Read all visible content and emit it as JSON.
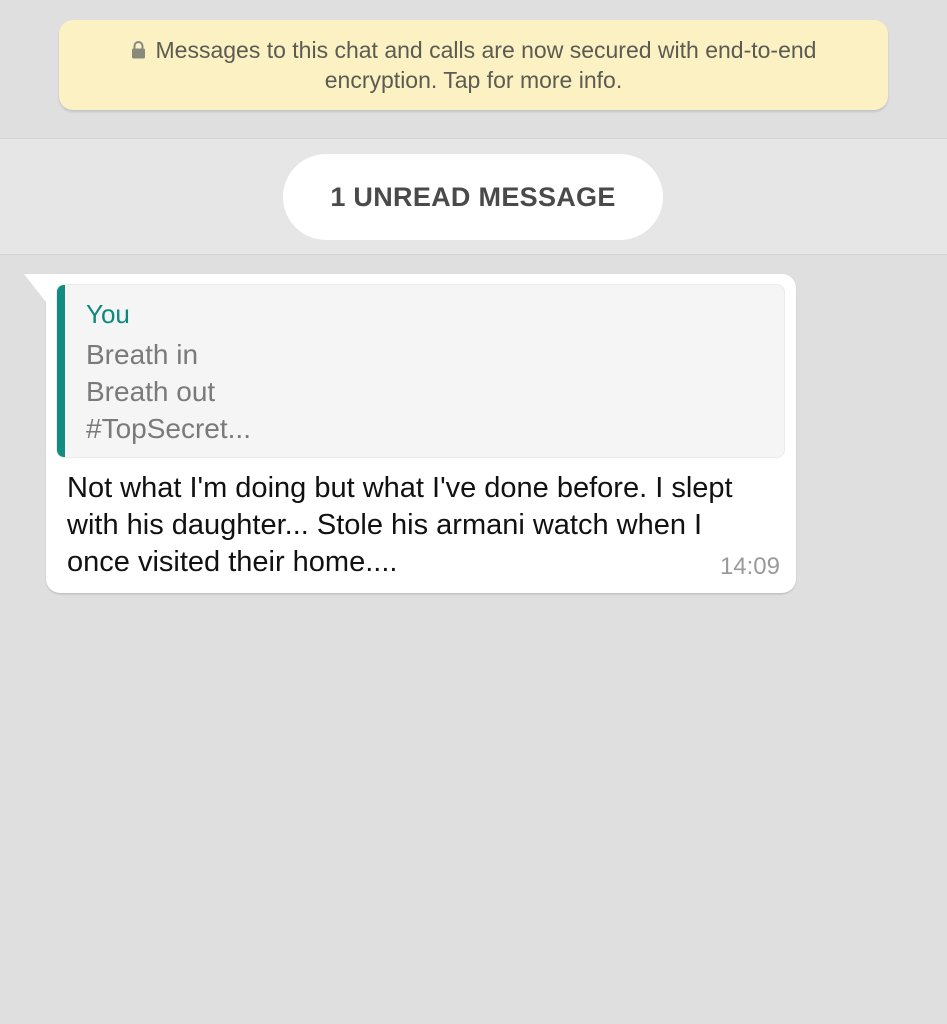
{
  "encryption_notice": {
    "text": "Messages to this chat and calls are now secured with end-to-end encryption. Tap for more info.",
    "icon": "lock-icon",
    "background": "#fbf1c3"
  },
  "unread_banner": {
    "label": "1 UNREAD MESSAGE"
  },
  "message": {
    "quoted": {
      "author": "You",
      "lines": [
        "Breath in",
        "Breath out",
        "#TopSecret..."
      ],
      "accent": "#128c7e"
    },
    "text": "Not what I'm doing but what I've done before. I slept with his daughter... Stole his armani watch when I once visited their home....",
    "time": "14:09"
  },
  "colors": {
    "chat_background": "#dfdfdf",
    "bubble": "#ffffff",
    "author_accent": "#0b8a7b"
  }
}
